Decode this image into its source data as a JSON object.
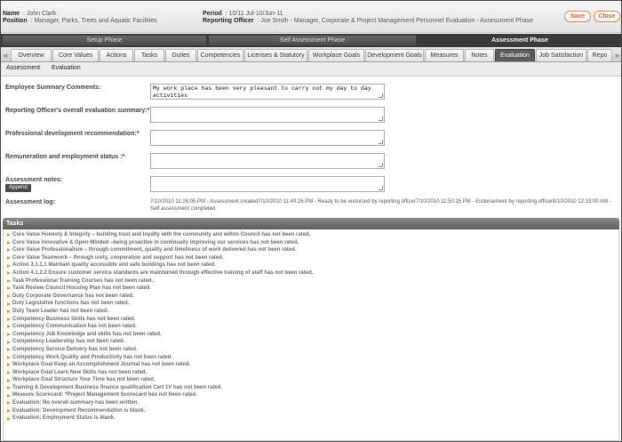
{
  "header": {
    "name_label": "Name",
    "name_value": ": John Clark",
    "position_label": "Position",
    "position_value": ": Manager, Parks, Trees and Aquatic Facilities",
    "period_label": "Period",
    "period_value": ": 10/11 Jul-10/Jun-11",
    "officer_label": "Reporting Officer",
    "officer_value": ": Joe Smith - Manager, Corporate & Project Management Personnel Evaluation - Assessment Phase",
    "save_label": "Save",
    "close_label": "Close"
  },
  "phases": [
    "Setup Phase",
    "Self Assessment Phase",
    "Assessment Phase"
  ],
  "tabs": {
    "left_arrow": "«",
    "right_arrow": "»",
    "items": [
      "Overview",
      "Core Values",
      "Actions",
      "Tasks",
      "Duties",
      "Competencies",
      "Licenses & Statutory",
      "Workplace Goals",
      "Development Goals",
      "Measures",
      "Notes",
      "Evaluation",
      "Job Satisfaction",
      "Repo"
    ]
  },
  "subtabs": [
    "Assessment",
    "Evaluation"
  ],
  "form": {
    "summary_label": "Employee Summary Comments:",
    "summary_value": "My work place has been very pleasant to carry out my day to day activities",
    "officer_summary_label": "Reporting Officer's overall evaluation summary:",
    "prof_dev_label": "Professional development recommendation:",
    "remuneration_label": "Remuneration and employment status :",
    "notes_label": "Assessment notes:",
    "append_label": "Append",
    "log_label": "Assessment log:",
    "log_text": "7/10/2010 11:26:05 PM - Assessment created7/10/2010 11:49:26 PM - Ready to be endorsed by reporting officer7/10/2010 11:50:25 PM - Endorsement by reporting officer8/10/2010 12:19:00 AM - Self assessment completed",
    "required_mark": "*"
  },
  "tasks": {
    "title": "Tasks",
    "items": [
      "Core Value Honesty & Integrity – building trust and loyalty with the community and within Council has not been rated.",
      "Core Value Innovative & Open-Minded –being proactive in continually improving our services has not been rated.",
      "Core Value Professionalism – through commitment, quality and timeliness of work delivered has not been rated.",
      "Core Value Teamwork – through unity, cooperation and support has not been rated.",
      "Action 3.1.1.1 Maintain quality accessible and safe buildings has not been rated.",
      "Action 4.1.2.2 Ensure customer service standards are maintained through effective training of staff has not been rated.",
      "Task Professional Training Courses has not been rated.",
      "Task Review Council Housing Plan has not been rated.",
      "Duty Corporate Governance has not been rated.",
      "Duty Legislative functions has not been rated.",
      "Duty Team Leader has not been rated.",
      "Competency Business Skills has not been rated.",
      "Competency Communication has not been rated.",
      "Competency Job Knowledge and skills has not been rated.",
      "Competency Leadership has not been rated.",
      "Competency Service Delivery has not been rated.",
      "Competency Work Quality and Productivity has not been rated.",
      "Workplace Goal Keep an Accomplishment Journal has not been rated.",
      "Workplace Goal Learn New Skills has not been rated.",
      "Workplace Goal Structure Your Time has not been rated.",
      "Training & Development Business finance qualification Cert 1V has not been rated.",
      "Measure Scorecard: *Project Management Scorecard has not been rated.",
      "Evaluation: No overall summary has been written.",
      "Evaluation: Development Recommendation is blank.",
      "Evaluation: Employment Status is blank."
    ]
  }
}
